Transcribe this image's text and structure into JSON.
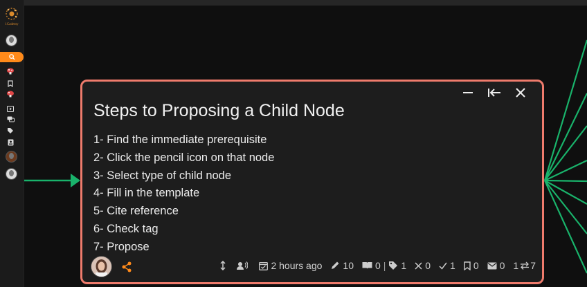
{
  "brand": {
    "logo_text": "1Cademy"
  },
  "card": {
    "title": "Steps to Proposing a Child Node",
    "steps": [
      "1- Find the immediate prerequisite",
      "2- Click the pencil icon on that node",
      "3- Select type of child node",
      "4- Fill in the template",
      "5- Cite reference",
      "6- Check tag",
      "7- Propose"
    ],
    "footer": {
      "timestamp": "2 hours ago",
      "upvotes": "10",
      "references": "0",
      "tags": "1",
      "wrong": "0",
      "correct": "1",
      "bookmarks": "0",
      "messages": "0",
      "links": "1",
      "links_children": "7"
    }
  },
  "colors": {
    "card_border": "#ee7b6c",
    "accent_orange": "#ff8a1a",
    "link_green": "#19b36b"
  }
}
